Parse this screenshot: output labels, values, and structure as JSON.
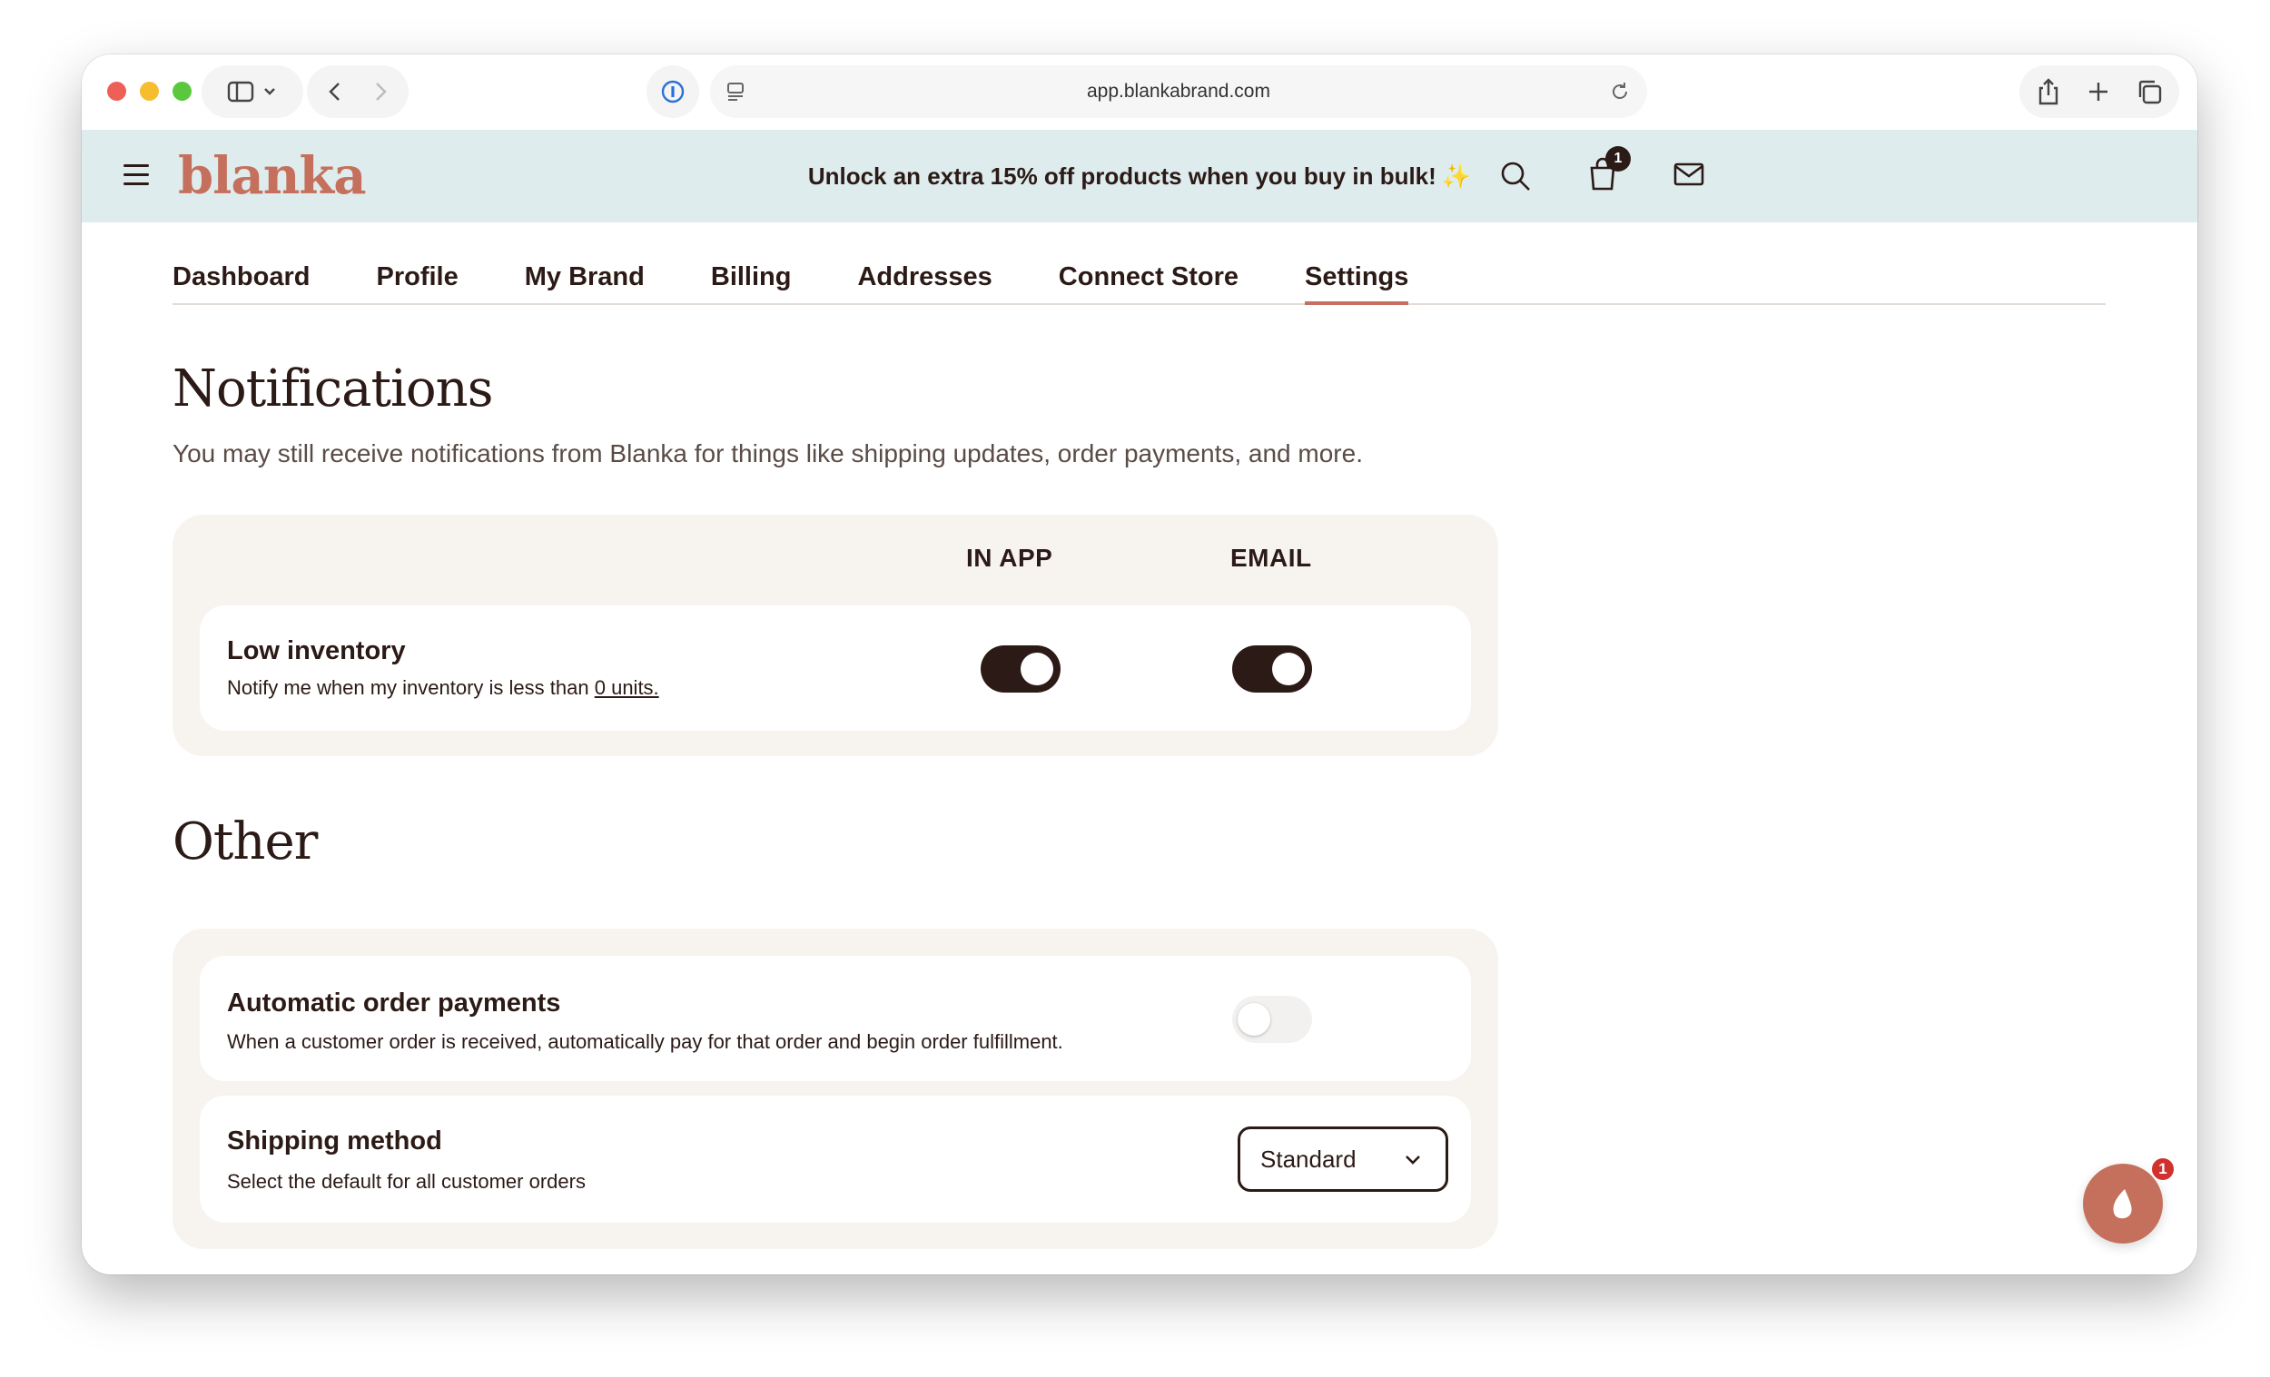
{
  "browser": {
    "url": "app.blankabrand.com"
  },
  "header": {
    "logo": "blanka",
    "promo": "Unlock an extra 15% off products when you buy in bulk!",
    "promo_emoji": "✨",
    "cart_count": "1"
  },
  "tabs": [
    {
      "label": "Dashboard"
    },
    {
      "label": "Profile"
    },
    {
      "label": "My Brand"
    },
    {
      "label": "Billing"
    },
    {
      "label": "Addresses"
    },
    {
      "label": "Connect Store"
    },
    {
      "label": "Settings"
    }
  ],
  "notifications": {
    "title": "Notifications",
    "subtitle": "You may still receive notifications from Blanka for things like shipping updates, order payments, and more.",
    "col_in_app": "IN APP",
    "col_email": "EMAIL",
    "low_inventory": {
      "title": "Low inventory",
      "desc": "Notify me when my inventory is less than",
      "threshold": "0 units.",
      "in_app_on": true,
      "email_on": true
    }
  },
  "other": {
    "title": "Other",
    "auto_payments": {
      "title": "Automatic order payments",
      "desc": "When a customer order is received, automatically pay for that order and begin order fulfillment.",
      "enabled": false
    },
    "shipping": {
      "title": "Shipping method",
      "desc": "Select the default for all customer orders",
      "selected": "Standard"
    }
  },
  "chat": {
    "badge": "1"
  },
  "colors": {
    "accent": "#c5705c",
    "dark": "#2b1a16",
    "promo_bg": "#deecee",
    "panel_bg": "#f7f4f0"
  }
}
